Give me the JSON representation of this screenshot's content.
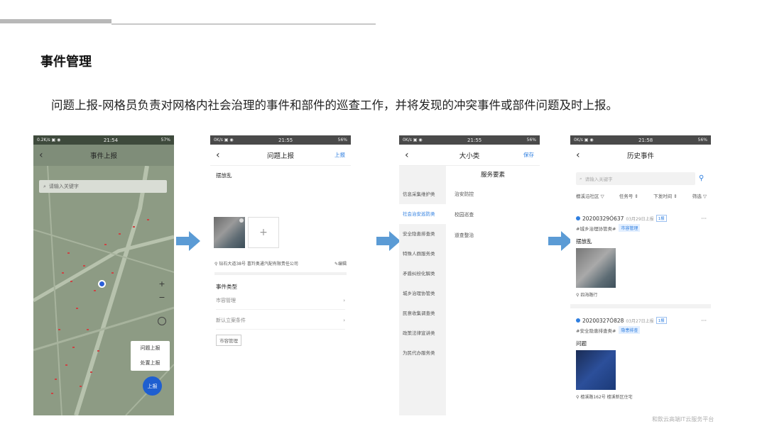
{
  "slide": {
    "title": "事件管理",
    "description": "问题上报-网格员负责对网格内社会治理的事件和部件的巡查工作，并将发现的冲突事件或部件问题及时上报。",
    "watermark": "和飲云高端IT云服务平台"
  },
  "phone1": {
    "status_left": "0.2K/s ▣ ◉",
    "status_time": "21:54",
    "status_right": "57%",
    "title": "事件上报",
    "search_placeholder": "请输入关键字",
    "zoom_in": "+",
    "zoom_out": "−",
    "menu": [
      "问题上报",
      "处置上报"
    ],
    "fab_label": "上报"
  },
  "phone2": {
    "status_left": "0K/s ▣ ◉",
    "status_time": "21:55",
    "status_right": "56%",
    "title": "问题上报",
    "action": "上报",
    "description_text": "摆放乱",
    "add_photo": "+",
    "location": "钻石大道38号 喜羚奥通汽配有限责任公司",
    "edit_label": "编辑",
    "section_title": "事件类型",
    "rows": [
      "市容管理",
      "新认立案条件"
    ],
    "tag": "市容管理"
  },
  "phone3": {
    "status_left": "0K/s ▣ ◉",
    "status_time": "21:55",
    "status_right": "56%",
    "title": "大小类",
    "action": "保存",
    "heading": "服务要素",
    "categories": [
      "信息采集维护类",
      "社会治安巡防类",
      "安全隐患排查类",
      "特殊人群服务类",
      "矛盾纠纷化解类",
      "城乡治理协管类",
      "民意收集调查类",
      "政策法律宣讲类",
      "为民代办服务类"
    ],
    "active_index": 1,
    "subitems": [
      "治安防控",
      "校园巡查",
      "道查整治"
    ]
  },
  "phone4": {
    "status_left": "0K/s ▣ ◉",
    "status_time": "21:58",
    "status_right": "56%",
    "title": "历史事件",
    "search_placeholder": "请输入关键字",
    "filters": [
      "檀溪沿社区 ▽",
      "任务号 ⇕",
      "下发时间 ⇕",
      "筛选 ▽"
    ],
    "events": [
      {
        "id": "20200329Ó637",
        "date": "03月29日上报",
        "badge": "1报",
        "tag1": "#城乡治理协管类#",
        "tag2": "市容管理",
        "title": "摆放乱",
        "location": "四海路行"
      },
      {
        "id": "20200327Ó828",
        "date": "03月27日上报",
        "badge": "1报",
        "tag1": "#安全隐患排查类#",
        "tag2": "隐患排查",
        "title": "问题",
        "location": "檀溪路162号 檀溪新区住宅"
      }
    ],
    "more_icon": "···"
  }
}
